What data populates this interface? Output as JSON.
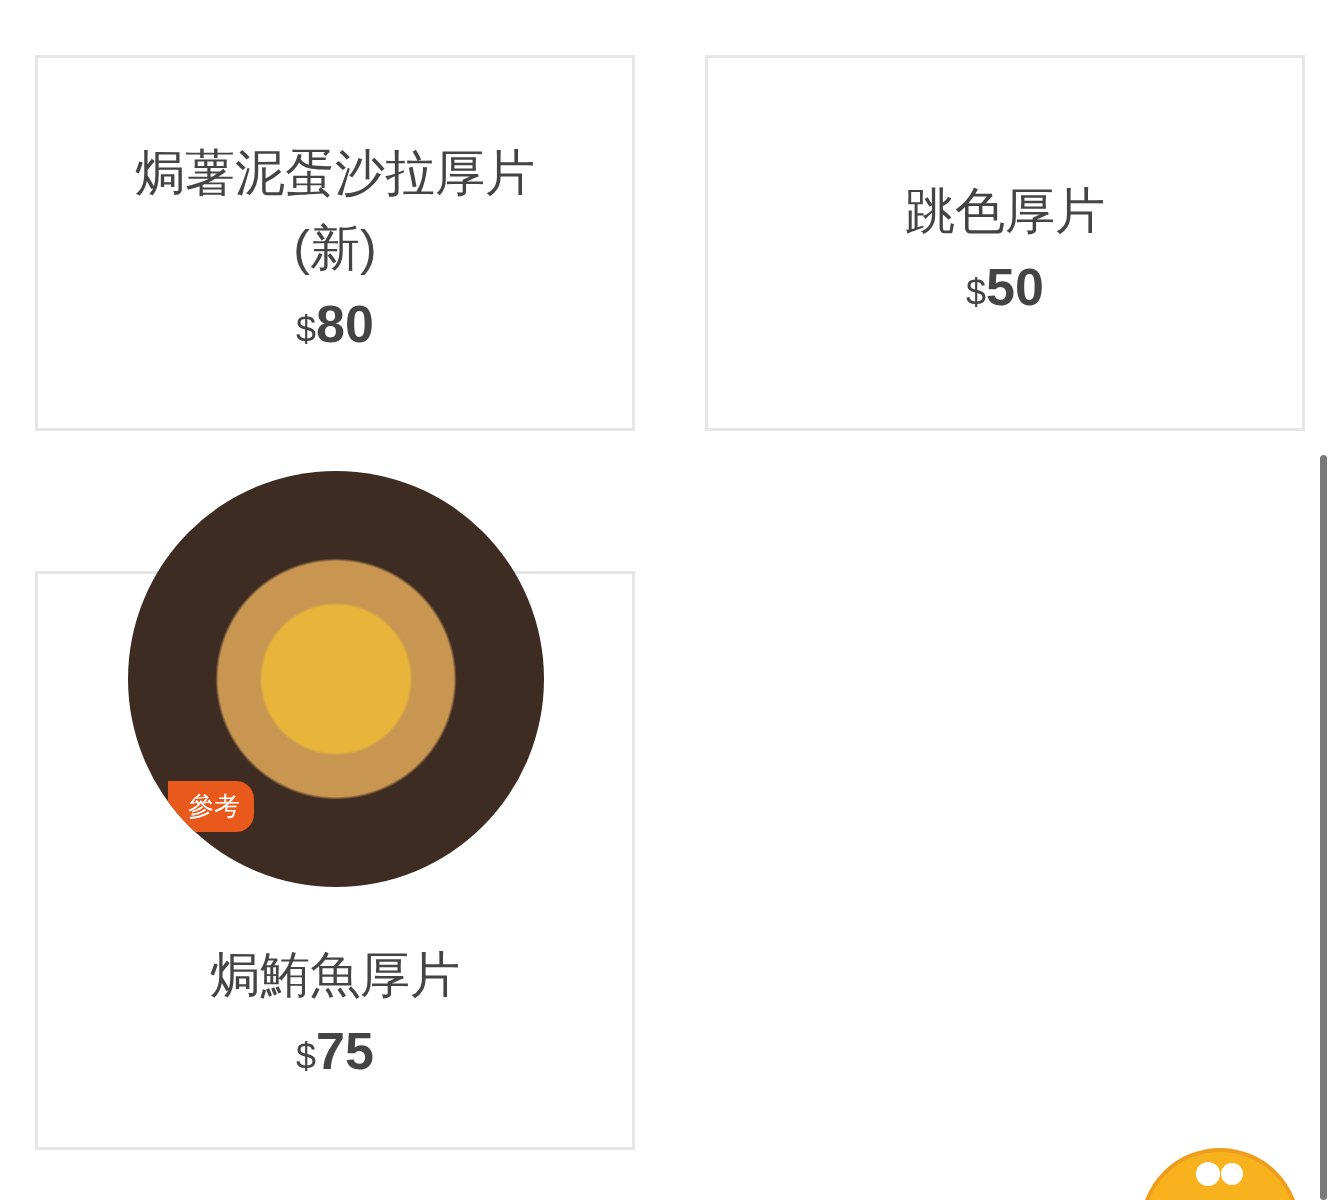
{
  "items": [
    {
      "name": "焗薯泥蛋沙拉厚片(新)",
      "currency": "$",
      "amount": "80",
      "photo": false
    },
    {
      "name": "跳色厚片",
      "currency": "$",
      "amount": "50",
      "photo": false
    },
    {
      "name": "焗鮪魚厚片",
      "currency": "$",
      "amount": "75",
      "photo": true,
      "badge": "參考"
    }
  ]
}
